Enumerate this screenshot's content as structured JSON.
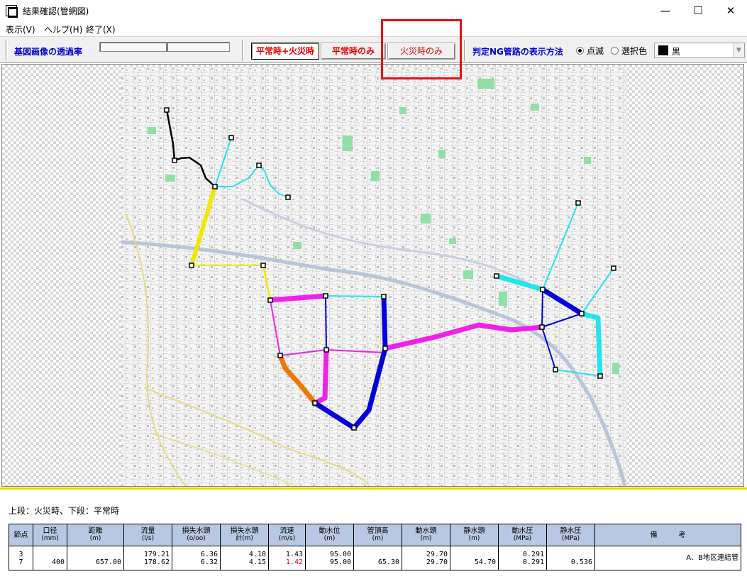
{
  "window": {
    "title": "結果確認(管網図)",
    "minimize": "—",
    "maximize": "☐",
    "close": "✕"
  },
  "menu": [
    "表示(V)",
    "ヘルプ(H)",
    "終了(X)"
  ],
  "toolbar": {
    "transparency_label": "基図画像の透過率",
    "mode_both": "平常時+火災時",
    "mode_normal": "平常時のみ",
    "mode_fire": "火災時のみ",
    "ng_label": "判定NG管路の表示方法",
    "radio_blink": "点滅",
    "radio_select": "選択色",
    "color_value": "黒",
    "colors": {
      "ng_swatch": "#000000"
    }
  },
  "result_panel": {
    "caption": "上段：火災時、下段：平常時",
    "headers": [
      {
        "label": "節点",
        "unit": ""
      },
      {
        "label": "口径",
        "unit": "(mm)"
      },
      {
        "label": "距離",
        "unit": "(m)"
      },
      {
        "label": "流量",
        "unit": "(l/s)"
      },
      {
        "label": "損失水頭",
        "unit": "(o/oo)"
      },
      {
        "label": "損失水頭",
        "unit": "計(m)"
      },
      {
        "label": "流速",
        "unit": "(m/s)"
      },
      {
        "label": "動水位",
        "unit": "(m)"
      },
      {
        "label": "管頂高",
        "unit": "(m)"
      },
      {
        "label": "動水頭",
        "unit": "(m)"
      },
      {
        "label": "静水頭",
        "unit": "(m)"
      },
      {
        "label": "動水圧",
        "unit": "(MPa)"
      },
      {
        "label": "静水圧",
        "unit": "(MPa)"
      },
      {
        "label": "備　　　考",
        "unit": ""
      }
    ],
    "row": {
      "node_top": "3",
      "node_bottom": "7",
      "diameter": "400",
      "distance": "657.00",
      "flow_top": "179.21",
      "flow_bottom": "178.62",
      "loss_top": "6.36",
      "loss_bottom": "6.32",
      "loss_total_top": "4.18",
      "loss_total_bottom": "4.15",
      "velocity_top": "1.43",
      "velocity_bottom": "1.42",
      "hydraulic_level_top": "95.00",
      "hydraulic_level_bottom": "95.00",
      "pipe_top_height": "65.30",
      "dynamic_head_top": "29.70",
      "dynamic_head_bottom": "29.70",
      "static_head": "54.70",
      "dynamic_pressure_top": "0.291",
      "dynamic_pressure_bottom": "0.291",
      "static_pressure": "0.536",
      "remarks": "A、B地区連結管"
    }
  },
  "pipe_colors": {
    "black": "#000000",
    "cyan": "#22e4f0",
    "yellow": "#f0e800",
    "magenta": "#f020e8",
    "orange": "#f07800",
    "blue": "#0000e0"
  }
}
